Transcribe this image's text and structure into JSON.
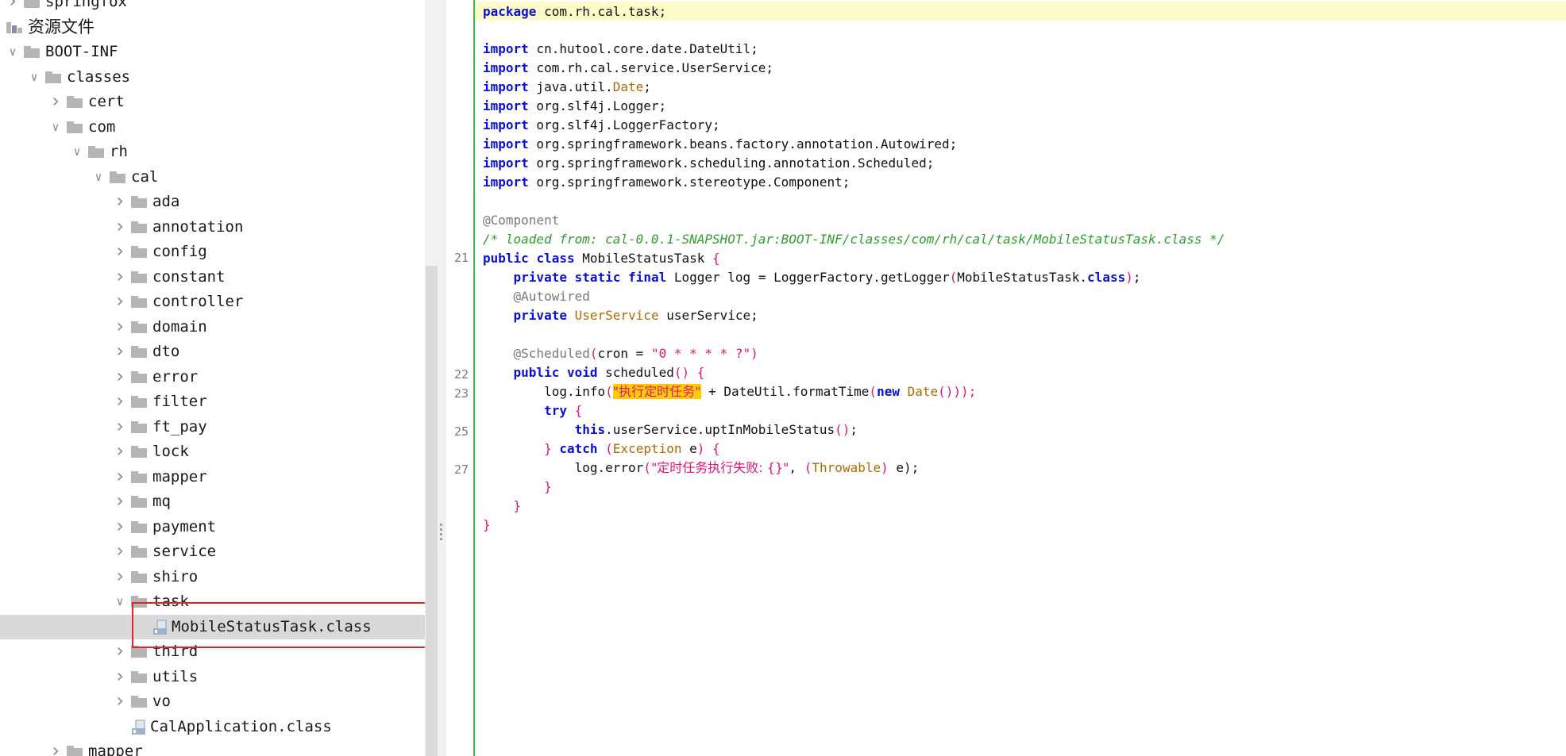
{
  "tree": {
    "rows": [
      {
        "label": "springfox",
        "type": "folder",
        "expand": "collapsed",
        "depth": 0
      },
      {
        "label": "资源文件",
        "type": "resources",
        "expand": "none",
        "depth": 0
      },
      {
        "label": "BOOT-INF",
        "type": "folder",
        "expand": "expanded",
        "depth": 0
      },
      {
        "label": "classes",
        "type": "folder",
        "expand": "expanded",
        "depth": 1
      },
      {
        "label": "cert",
        "type": "folder",
        "expand": "collapsed",
        "depth": 2
      },
      {
        "label": "com",
        "type": "folder",
        "expand": "expanded",
        "depth": 2
      },
      {
        "label": "rh",
        "type": "folder",
        "expand": "expanded",
        "depth": 3
      },
      {
        "label": "cal",
        "type": "folder",
        "expand": "expanded",
        "depth": 4
      },
      {
        "label": "ada",
        "type": "folder",
        "expand": "collapsed",
        "depth": 5
      },
      {
        "label": "annotation",
        "type": "folder",
        "expand": "collapsed",
        "depth": 5
      },
      {
        "label": "config",
        "type": "folder",
        "expand": "collapsed",
        "depth": 5
      },
      {
        "label": "constant",
        "type": "folder",
        "expand": "collapsed",
        "depth": 5
      },
      {
        "label": "controller",
        "type": "folder",
        "expand": "collapsed",
        "depth": 5
      },
      {
        "label": "domain",
        "type": "folder",
        "expand": "collapsed",
        "depth": 5
      },
      {
        "label": "dto",
        "type": "folder",
        "expand": "collapsed",
        "depth": 5
      },
      {
        "label": "error",
        "type": "folder",
        "expand": "collapsed",
        "depth": 5
      },
      {
        "label": "filter",
        "type": "folder",
        "expand": "collapsed",
        "depth": 5
      },
      {
        "label": "ft_pay",
        "type": "folder",
        "expand": "collapsed",
        "depth": 5
      },
      {
        "label": "lock",
        "type": "folder",
        "expand": "collapsed",
        "depth": 5
      },
      {
        "label": "mapper",
        "type": "folder",
        "expand": "collapsed",
        "depth": 5
      },
      {
        "label": "mq",
        "type": "folder",
        "expand": "collapsed",
        "depth": 5
      },
      {
        "label": "payment",
        "type": "folder",
        "expand": "collapsed",
        "depth": 5
      },
      {
        "label": "service",
        "type": "folder",
        "expand": "collapsed",
        "depth": 5
      },
      {
        "label": "shiro",
        "type": "folder",
        "expand": "collapsed",
        "depth": 5
      },
      {
        "label": "task",
        "type": "folder",
        "expand": "expanded",
        "depth": 5
      },
      {
        "label": "MobileStatusTask.class",
        "type": "class",
        "expand": "none",
        "depth": 6,
        "selected": true
      },
      {
        "label": "third",
        "type": "folder",
        "expand": "collapsed",
        "depth": 5
      },
      {
        "label": "utils",
        "type": "folder",
        "expand": "collapsed",
        "depth": 5
      },
      {
        "label": "vo",
        "type": "folder",
        "expand": "collapsed",
        "depth": 5
      },
      {
        "label": "CalApplication.class",
        "type": "class",
        "expand": "none",
        "depth": 5
      },
      {
        "label": "mapper",
        "type": "folder",
        "expand": "collapsed",
        "depth": 2
      }
    ]
  },
  "editor": {
    "line_numbers": [
      {
        "line": 1,
        "num": "21"
      },
      {
        "line": 2,
        "num": "22"
      },
      {
        "line": 3,
        "num": "23"
      },
      {
        "line": 4,
        "num": "25"
      },
      {
        "line": 5,
        "num": "27"
      }
    ],
    "code": {
      "package_kw": "package",
      "package_name": " com.rh.cal.task;",
      "import_kw": "import",
      "imports": [
        " cn.hutool.core.date.DateUtil;",
        " com.rh.cal.service.UserService;",
        " java.util.",
        " org.slf4j.Logger;",
        " org.slf4j.LoggerFactory;",
        " org.springframework.beans.factory.annotation.Autowired;",
        " org.springframework.scheduling.annotation.Scheduled;",
        " org.springframework.stereotype.Component;"
      ],
      "date_type": "Date",
      "semicolon": ";",
      "component_annotation": "@Component",
      "loaded_from_comment": "/* loaded from: cal-0.0.1-SNAPSHOT.jar:BOOT-INF/classes/com/rh/cal/task/MobileStatusTask.class */",
      "kw_public": "public",
      "kw_class": "class",
      "class_name": " MobileStatusTask ",
      "open_brace": "{",
      "close_brace": "}",
      "kw_private": "private",
      "kw_static": "static",
      "kw_final": "final",
      "logger_decl": " Logger log = LoggerFactory.getLogger",
      "logger_arg": "MobileStatusTask.",
      "kw_class_ref": "class",
      "paren_semicolon": ");",
      "autowired_annotation": "@Autowired",
      "userservice_type": "UserService",
      "userservice_field": " userService;",
      "scheduled_annotation": "@Scheduled",
      "cron_open": "(",
      "cron_key": "cron = ",
      "cron_value": "\"0 * * * * ?\"",
      "cron_close": ")",
      "kw_void": "void",
      "method_name": " scheduled",
      "parens": "()",
      "log_info": "log.info",
      "info_string": "\"执行定时任务\"",
      "info_concat": " + DateUtil.formatTime",
      "kw_new": "new",
      "info_close": "()));",
      "kw_try": "try",
      "kw_this": "this",
      "upt_call": ".userService.uptInMobileStatus",
      "upt_tail": "();",
      "kw_catch": "catch",
      "exception_type": "Exception",
      "catch_var": " e",
      "log_error": "log.error",
      "error_string": "\"定时任务执行失败: {}\"",
      "comma": ", ",
      "throwable_type": "Throwable",
      "error_tail": " e);"
    }
  },
  "colors": {
    "keyword": "#0a0fd6",
    "string": "#e0137a",
    "type": "#b06a00",
    "comment": "#2e9e2e",
    "annotation": "#7a7a7a",
    "highlight_box": "#e0232a",
    "selection": "#d9d9d9",
    "gutter_line": "#4caf50",
    "current_line": "#fdfbc8"
  }
}
